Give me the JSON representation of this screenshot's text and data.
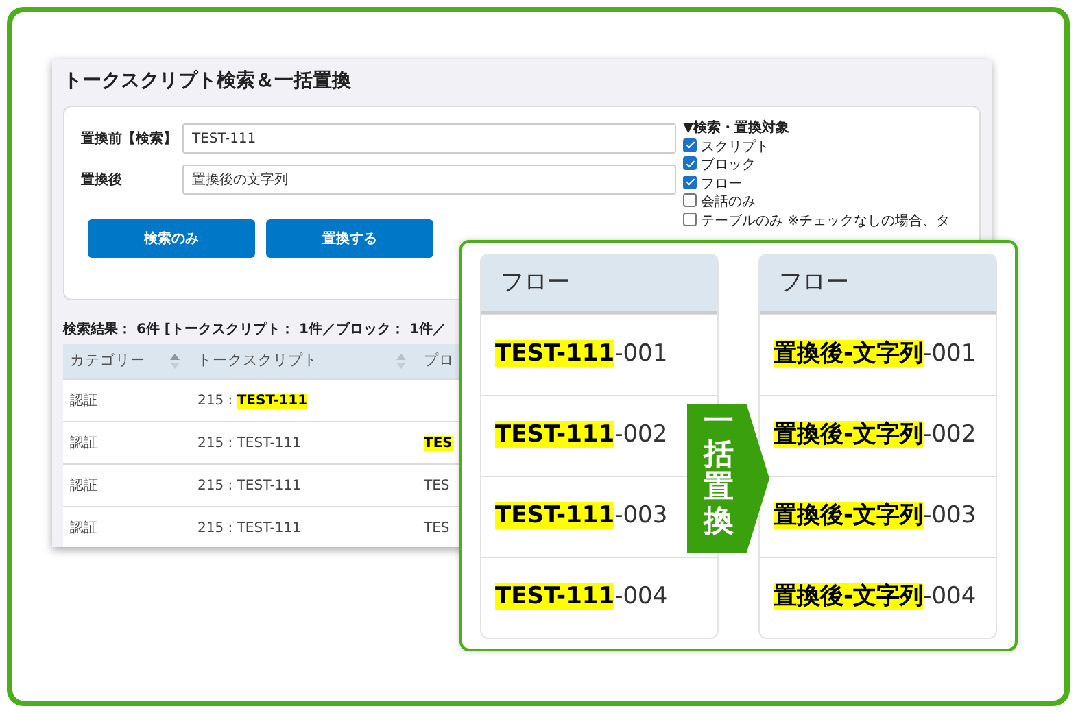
{
  "window": {
    "title": "トークスクリプト検索＆一括置換"
  },
  "form": {
    "fields": [
      {
        "label": "置換前【検索】",
        "value": "TEST-111"
      },
      {
        "label": "置換後",
        "value": "置換後の文字列"
      }
    ],
    "targets_heading": "▼検索・置換対象",
    "targets": [
      {
        "label": "スクリプト",
        "checked": true
      },
      {
        "label": "ブロック",
        "checked": true
      },
      {
        "label": "フロー",
        "checked": true
      },
      {
        "label": "会話のみ",
        "checked": false
      },
      {
        "label": "テーブルのみ ※チェックなしの場合、タ",
        "checked": false
      }
    ],
    "buttons": [
      "検索のみ",
      "置換する"
    ]
  },
  "results_summary": "検索結果： 6件 [トークスクリプト： 1件／ブロック： 1件／",
  "table": {
    "columns": [
      {
        "label": "カテゴリー",
        "sortable": true
      },
      {
        "label": "トークスクリプト",
        "sortable": true
      },
      {
        "label": "プロ",
        "sortable": false
      }
    ],
    "rows": [
      [
        {
          "text": "認証"
        },
        {
          "text": "215 : ",
          "highlight": "TEST-111"
        },
        {
          "text": ""
        }
      ],
      [
        {
          "text": "認証"
        },
        {
          "text": "215 : TEST-111"
        },
        {
          "highlight": "TES"
        }
      ],
      [
        {
          "text": "認証"
        },
        {
          "text": "215 : TEST-111"
        },
        {
          "text": "TES"
        }
      ],
      [
        {
          "text": "認証"
        },
        {
          "text": "215 : TEST-111"
        },
        {
          "text": "TES"
        }
      ]
    ]
  },
  "comparison": {
    "before": {
      "heading": "フロー",
      "items": [
        {
          "highlight": "TEST-111",
          "text": "-001"
        },
        {
          "highlight": "TEST-111",
          "text": "-002"
        },
        {
          "highlight": "TEST-111",
          "text": "-003"
        },
        {
          "highlight": "TEST-111",
          "text": "-004"
        }
      ]
    },
    "badge": "一括置換",
    "after": {
      "heading": "フロー",
      "items": [
        {
          "highlight": "置換後-文字列",
          "text": "-001"
        },
        {
          "highlight": "置換後-文字列",
          "text": "-002"
        },
        {
          "highlight": "置換後-文字列",
          "text": "-003"
        },
        {
          "highlight": "置換後-文字列",
          "text": "-004"
        }
      ]
    }
  }
}
